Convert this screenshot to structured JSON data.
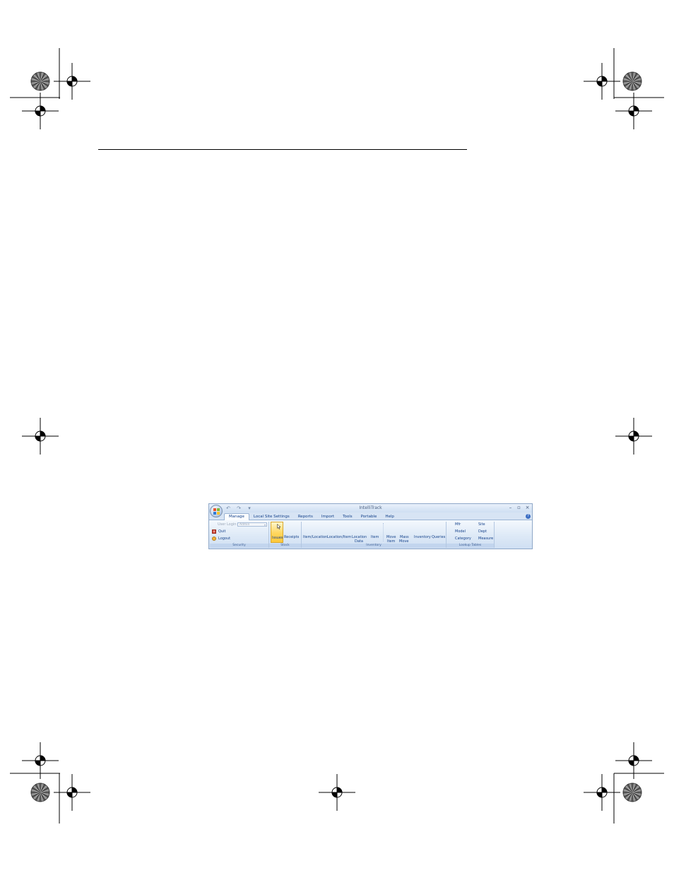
{
  "window": {
    "title": "IntelliTrack",
    "quick_access": [
      "↶",
      "↷",
      "▾"
    ],
    "controls": [
      "–",
      "▫",
      "×"
    ]
  },
  "tabs": [
    {
      "label": "Manage",
      "active": true
    },
    {
      "label": "Local Site Settings",
      "active": false
    },
    {
      "label": "Reports",
      "active": false
    },
    {
      "label": "Import",
      "active": false
    },
    {
      "label": "Tools",
      "active": false
    },
    {
      "label": "Portable",
      "active": false
    },
    {
      "label": "Help",
      "active": false
    }
  ],
  "help_icon": "?",
  "ribbon": {
    "security": {
      "label": "Security",
      "user_login_label": "User Login:",
      "user_login_value": "Admin",
      "quit": "Quit",
      "logout": "Logout"
    },
    "stock": {
      "label": "Stock",
      "issues": "Issues",
      "receipts": "Receipts"
    },
    "inventory": {
      "label": "Inventory",
      "item_location": "Item/Location",
      "location_item": "Location/Item",
      "location_line1": "Location",
      "location_line2": "Data",
      "item": "Item",
      "move_line1": "Move",
      "move_line2": "Item",
      "mass_line1": "Mass",
      "mass_line2": "Move",
      "inventory": "Inventory",
      "queries": "Queries"
    },
    "lookup_tables": {
      "label": "Lookup Tables",
      "mfr": "Mfr",
      "site": "Site",
      "model": "Model",
      "dept": "Dept",
      "category": "Category",
      "measure": "Measure"
    }
  },
  "colors": {
    "tab_text": "#15428b",
    "ribbon_bg": "#dce8f6",
    "active_button": "#ffd65e"
  }
}
